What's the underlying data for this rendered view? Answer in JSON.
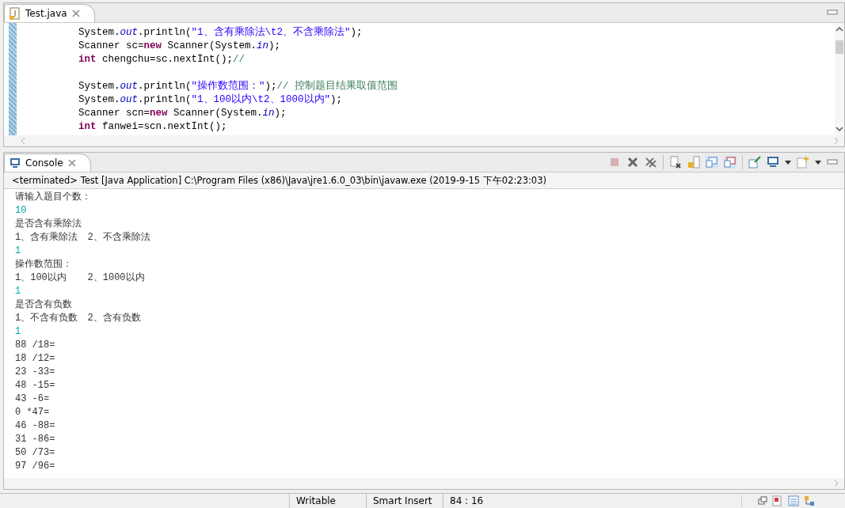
{
  "editor": {
    "tab": {
      "label": "Test.java"
    },
    "lines": [
      {
        "kind": "code",
        "tokens": [
          {
            "kind": "plain",
            "text": "System."
          },
          {
            "kind": "field",
            "text": "out"
          },
          {
            "kind": "plain",
            "text": ".println("
          },
          {
            "kind": "string",
            "text": "\"1、含有乘除法\\t2、不含乘除法\""
          },
          {
            "kind": "plain",
            "text": ");"
          }
        ]
      },
      {
        "kind": "code",
        "tokens": [
          {
            "kind": "plain",
            "text": "Scanner sc="
          },
          {
            "kind": "keyword",
            "text": "new"
          },
          {
            "kind": "plain",
            "text": " Scanner(System."
          },
          {
            "kind": "field",
            "text": "in"
          },
          {
            "kind": "plain",
            "text": ");"
          }
        ]
      },
      {
        "kind": "code",
        "tokens": [
          {
            "kind": "keyword",
            "text": "int"
          },
          {
            "kind": "plain",
            "text": " chengchu=sc.nextInt();"
          },
          {
            "kind": "comment",
            "text": "//"
          }
        ]
      },
      {
        "kind": "blank"
      },
      {
        "kind": "code",
        "tokens": [
          {
            "kind": "plain",
            "text": "System."
          },
          {
            "kind": "field",
            "text": "out"
          },
          {
            "kind": "plain",
            "text": ".println("
          },
          {
            "kind": "string",
            "text": "\"操作数范围：\""
          },
          {
            "kind": "plain",
            "text": ");"
          },
          {
            "kind": "comment",
            "text": "// 控制题目结果取值范围"
          }
        ]
      },
      {
        "kind": "code",
        "tokens": [
          {
            "kind": "plain",
            "text": "System."
          },
          {
            "kind": "field",
            "text": "out"
          },
          {
            "kind": "plain",
            "text": ".println("
          },
          {
            "kind": "string",
            "text": "\"1、100以内\\t2、1000以内\""
          },
          {
            "kind": "plain",
            "text": ");"
          }
        ]
      },
      {
        "kind": "code",
        "tokens": [
          {
            "kind": "plain",
            "text": "Scanner scn="
          },
          {
            "kind": "keyword",
            "text": "new"
          },
          {
            "kind": "plain",
            "text": " Scanner(System."
          },
          {
            "kind": "field",
            "text": "in"
          },
          {
            "kind": "plain",
            "text": ");"
          }
        ]
      },
      {
        "kind": "code",
        "tokens": [
          {
            "kind": "keyword",
            "text": "int"
          },
          {
            "kind": "plain",
            "text": " fanwei=scn.nextInt();"
          }
        ]
      }
    ]
  },
  "console": {
    "tab": {
      "label": "Console"
    },
    "header": "<terminated> Test [Java Application] C:\\Program Files (x86)\\Java\\jre1.6.0_03\\bin\\javaw.exe (2019-9-15 下午02:23:03)",
    "lines": [
      {
        "kind": "output",
        "text": "请输入题目个数："
      },
      {
        "kind": "input",
        "text": "10"
      },
      {
        "kind": "output",
        "text": "是否含有乘除法"
      },
      {
        "kind": "output",
        "text": "1、含有乘除法\t2、不含乘除法"
      },
      {
        "kind": "input",
        "text": "1"
      },
      {
        "kind": "output",
        "text": "操作数范围："
      },
      {
        "kind": "output",
        "text": "1、100以内\t2、1000以内"
      },
      {
        "kind": "input",
        "text": "1"
      },
      {
        "kind": "output",
        "text": "是否含有负数"
      },
      {
        "kind": "output",
        "text": "1、不含有负数\t2、含有负数"
      },
      {
        "kind": "input",
        "text": "1"
      },
      {
        "kind": "output",
        "text": "88 /18="
      },
      {
        "kind": "output",
        "text": "18 /12="
      },
      {
        "kind": "output",
        "text": "23 -33="
      },
      {
        "kind": "output",
        "text": "48 -15="
      },
      {
        "kind": "output",
        "text": "43 -6="
      },
      {
        "kind": "output",
        "text": "0 *47="
      },
      {
        "kind": "output",
        "text": "46 -88="
      },
      {
        "kind": "output",
        "text": "31 -86="
      },
      {
        "kind": "output",
        "text": "50 /73="
      },
      {
        "kind": "output",
        "text": "97 /96="
      }
    ]
  },
  "status_bar": [
    "Writable",
    "Smart Insert",
    "84 : 16"
  ]
}
